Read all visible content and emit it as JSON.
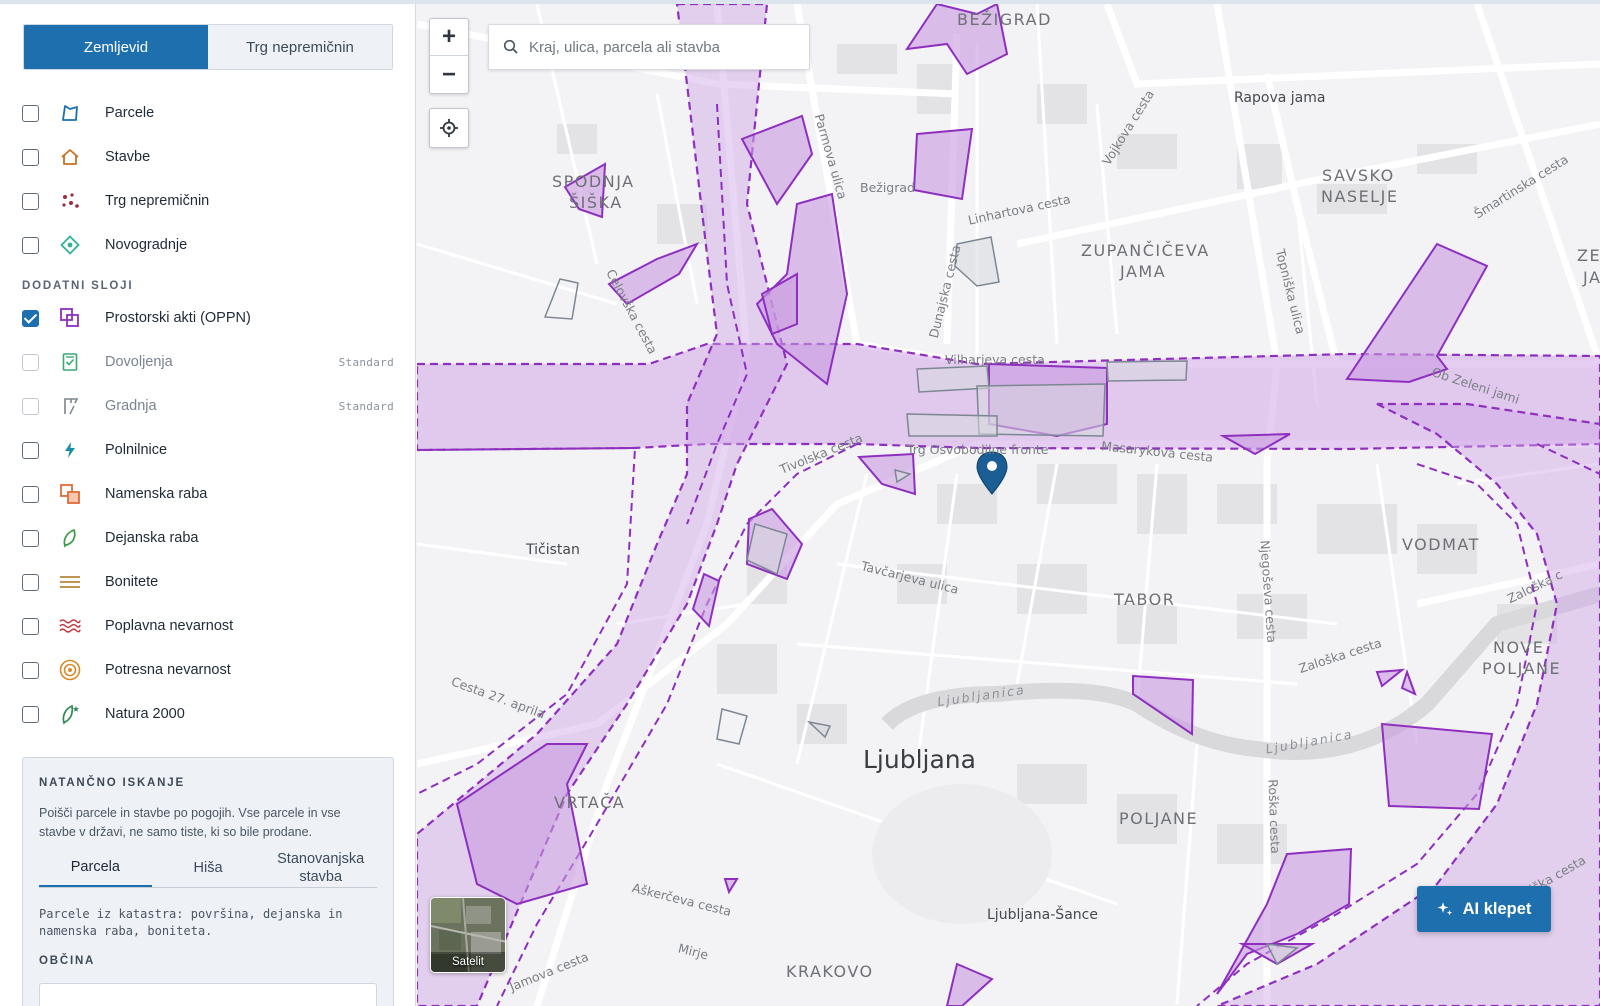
{
  "sidebar": {
    "tabs": [
      {
        "label": "Zemljevid",
        "active": true
      },
      {
        "label": "Trg nepremičnin",
        "active": false
      }
    ],
    "layers": [
      {
        "label": "Parcele",
        "checked": false,
        "icon": "parcel-icon"
      },
      {
        "label": "Stavbe",
        "checked": false,
        "icon": "building-icon"
      },
      {
        "label": "Trg nepremičnin",
        "checked": false,
        "icon": "market-dots-icon"
      },
      {
        "label": "Novogradnje",
        "checked": false,
        "icon": "new-build-icon"
      }
    ],
    "additional_heading": "DODATNI SLOJI",
    "additional_layers": [
      {
        "label": "Prostorski akti (OPPN)",
        "checked": true,
        "icon": "spatial-acts-icon"
      },
      {
        "label": "Dovoljenja",
        "checked": false,
        "disabled": true,
        "badge": "Standard",
        "icon": "permit-icon"
      },
      {
        "label": "Gradnja",
        "checked": false,
        "disabled": true,
        "badge": "Standard",
        "icon": "crane-icon"
      },
      {
        "label": "Polnilnice",
        "checked": false,
        "icon": "lightning-icon"
      },
      {
        "label": "Namenska raba",
        "checked": false,
        "icon": "land-use-icon"
      },
      {
        "label": "Dejanska raba",
        "checked": false,
        "icon": "leaf-icon"
      },
      {
        "label": "Bonitete",
        "checked": false,
        "icon": "lines-icon"
      },
      {
        "label": "Poplavna nevarnost",
        "checked": false,
        "icon": "waves-icon"
      },
      {
        "label": "Potresna nevarnost",
        "checked": false,
        "icon": "target-icon"
      },
      {
        "label": "Natura 2000",
        "checked": false,
        "icon": "natura-leaf-icon"
      }
    ],
    "search": {
      "heading": "NATANČNO ISKANJE",
      "description": "Poišči parcele in stavbe po pogojih. Vse parcele in vse stavbe v državi, ne samo tiste, ki so bile prodane.",
      "tabs": [
        {
          "label": "Parcela",
          "active": true
        },
        {
          "label": "Hiša",
          "active": false
        },
        {
          "label": "Stanovanjska stavba",
          "active": false
        }
      ],
      "mono_text": "Parcele iz katastra: površina, dejanska in namenska raba, boniteta.",
      "obcina_label": "OBČINA"
    }
  },
  "map": {
    "search_placeholder": "Kraj, ulica, parcela ali stavba",
    "zoom_in": "+",
    "zoom_out": "−",
    "satellite_label": "Satelit",
    "ai_button": "AI klepet",
    "labels": {
      "bezigrad_d": "BEŽIGRAD",
      "rapova": "Rapova jama",
      "spodnja1": "SPODNJA",
      "spodnja2": "ŠIŠKA",
      "savsko1": "SAVSKO",
      "savsko2": "NASELJE",
      "zupan1": "ZUPANČIČEVA",
      "zupan2": "JAMA",
      "ze1": "ZE",
      "ze2": "JA",
      "bezigrad_p": "Bežigrad",
      "linhartova": "Linhartova cesta",
      "vojkova": "Vojkova cesta",
      "dunajska": "Dunajska cesta",
      "topniska": "Topniška ulica",
      "smartinska": "Šmartinska cesta",
      "celovska": "Celovška cesta",
      "parmova": "Parmova ulica",
      "vilharjeva": "Vilharjeva cesta",
      "ozelenijami": "Ob Zeleni jami",
      "tivolska": "Tivolska cesta",
      "trg_of": "Trg Osvobodilne fronte",
      "masarykova": "Masarykova cesta",
      "ticistan": "Tičistan",
      "tavcarjeva": "Tavčarjeva ulica",
      "tabor": "TABOR",
      "vodmat": "VODMAT",
      "njegoseva": "Njegoševa cesta",
      "zaloska1": "Zaloška cesta",
      "zaloska2": "Zaloška c",
      "nove1": "NOVE",
      "nove2": "POLJANE",
      "cesta27": "Cesta 27. aprila",
      "ljubljanica1": "Ljubljanica",
      "ljubljanica2": "Ljubljanica",
      "ljubljana": "Ljubljana",
      "vrtaca": "VRTAČA",
      "poljane": "POLJANE",
      "roska": "Roška cesta",
      "askerceva": "Aškerčeva cesta",
      "sance": "Ljubljana-Šance",
      "mirje": "Mirje",
      "krakovo": "KRAKOVO",
      "jamova": "Jamova cesta",
      "dolenjska": "radiška cesta"
    }
  },
  "colors": {
    "accent": "#1d6fae",
    "oppn_stroke": "#8e2fc0",
    "oppn_fill": "#c89ae0",
    "marker": "#1b5e96"
  }
}
